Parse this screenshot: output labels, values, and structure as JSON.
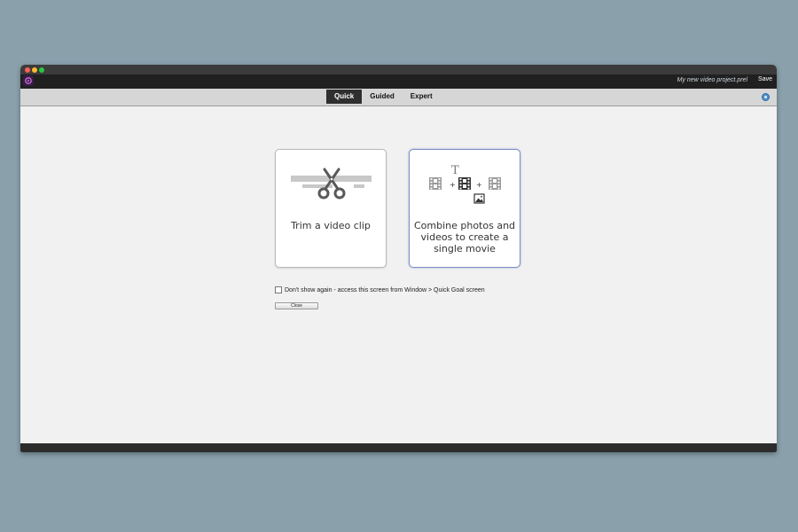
{
  "app": {
    "project_title": "My new video project.prel",
    "save_label": "Save"
  },
  "mode_tabs": [
    {
      "label": "Quick",
      "active": true
    },
    {
      "label": "Guided",
      "active": false
    },
    {
      "label": "Expert",
      "active": false
    }
  ],
  "goal_cards": [
    {
      "label": "Trim a video clip",
      "icon": "scissors-icon",
      "selected": false
    },
    {
      "label": "Combine photos and videos to create a single movie",
      "icon": "combine-media-icon",
      "selected": true
    }
  ],
  "dont_show": {
    "checked": false,
    "label": "Don't show again - access this screen from Window > Quick Goal screen"
  },
  "close_label": "Close",
  "colors": {
    "desktop_background": "#8aa1ac",
    "window_background": "#f1f1f1",
    "active_tab": "#2f2f2f",
    "selected_card_border": "#7d8ec2",
    "help_icon": "#4f8ec9"
  }
}
